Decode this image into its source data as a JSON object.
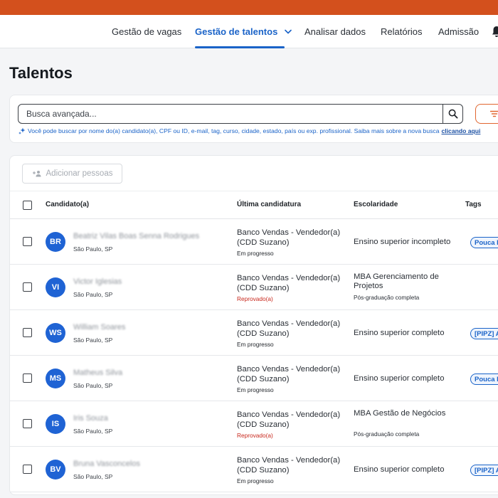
{
  "nav": {
    "items": [
      {
        "label": "Gestão de vagas",
        "active": false
      },
      {
        "label": "Gestão de talentos",
        "active": true
      },
      {
        "label": "Analisar dados",
        "active": false
      },
      {
        "label": "Relatórios",
        "active": false
      },
      {
        "label": "Admissão",
        "active": false
      }
    ]
  },
  "page": {
    "title": "Talentos"
  },
  "search": {
    "placeholder": "Busca avançada...",
    "hint": "Você pode buscar por nome do(a) candidato(a), CPF ou ID, e-mail, tag, curso, cidade, estado, país ou exp. profissional. Saiba mais sobre a nova busca",
    "hint_link": "clicando aqui"
  },
  "table": {
    "add_label": "Adicionar pessoas",
    "headers": {
      "candidate": "Candidato(a)",
      "last_application": "Última candidatura",
      "education": "Escolaridade",
      "tags": "Tags"
    },
    "rows": [
      {
        "initials": "BR",
        "name": "Beatriz Vilas Boas Senna Rodrigues",
        "location": "São Paulo, SP",
        "job": "Banco Vendas - Vendedor(a) (CDD Suzano)",
        "status": "Em progresso",
        "status_type": "progress",
        "education": "Ensino superior incompleto",
        "education_detail": "",
        "tag": "Pouca E"
      },
      {
        "initials": "VI",
        "name": "Victor Iglesias",
        "location": "São Paulo, SP",
        "job": "Banco Vendas - Vendedor(a) (CDD Suzano)",
        "status": "Reprovado(a)",
        "status_type": "rejected",
        "education": "MBA Gerenciamento de Projetos",
        "education_detail": "Pós-graduação completa",
        "tag": ""
      },
      {
        "initials": "WS",
        "name": "William Soares",
        "location": "São Paulo, SP",
        "job": "Banco Vendas - Vendedor(a) (CDD Suzano)",
        "status": "Em progresso",
        "status_type": "progress",
        "education": "Ensino superior completo",
        "education_detail": "",
        "tag": "[PIPZ] A"
      },
      {
        "initials": "MS",
        "name": "Matheus Silva",
        "location": "São Paulo, SP",
        "job": "Banco Vendas - Vendedor(a) (CDD Suzano)",
        "status": "Em progresso",
        "status_type": "progress",
        "education": "Ensino superior completo",
        "education_detail": "",
        "tag": "Pouca E"
      },
      {
        "initials": "IS",
        "name": "Iris Souza",
        "location": "São Paulo, SP",
        "job": "Banco Vendas - Vendedor(a) (CDD Suzano)",
        "status": "Reprovado(a)",
        "status_type": "rejected",
        "education": "MBA Gestão de Negócios",
        "education_detail": "Pós-graduação completa",
        "tag": ""
      },
      {
        "initials": "BV",
        "name": "Bruna Vasconcelos",
        "location": "São Paulo, SP",
        "job": "Banco Vendas - Vendedor(a) (CDD Suzano)",
        "status": "Em progresso",
        "status_type": "progress",
        "education": "Ensino superior completo",
        "education_detail": "",
        "tag": "[PIPZ] A"
      }
    ]
  },
  "colors": {
    "top_bar": "#d3501d",
    "accent": "#1a63c8",
    "avatar": "#1f63d4",
    "rejected": "#c8271c",
    "filter_border": "#e1662f"
  }
}
